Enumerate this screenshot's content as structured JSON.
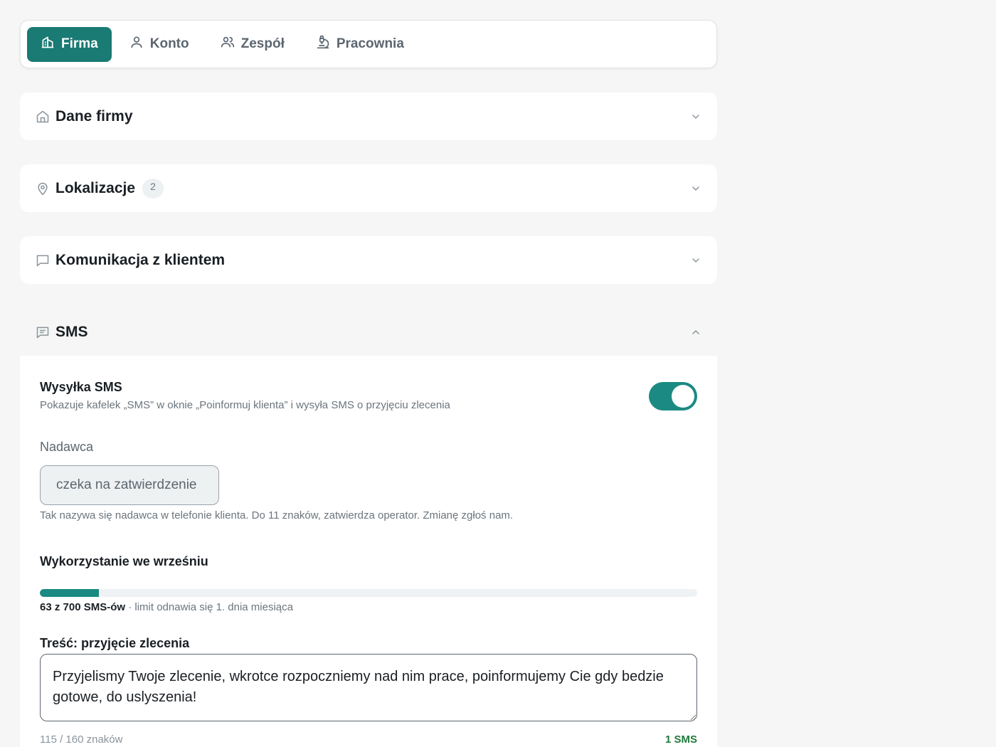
{
  "tabs": [
    {
      "label": "Firma",
      "icon": "building-icon",
      "active": true
    },
    {
      "label": "Konto",
      "icon": "user-icon",
      "active": false
    },
    {
      "label": "Zespół",
      "icon": "users-icon",
      "active": false
    },
    {
      "label": "Pracownia",
      "icon": "microscope-icon",
      "active": false
    }
  ],
  "sections": [
    {
      "title": "Dane firmy",
      "icon": "home-icon"
    },
    {
      "title": "Lokalizacje",
      "icon": "map-pin-icon",
      "badge": "2"
    },
    {
      "title": "Komunikacja z klientem",
      "icon": "chat-bubble-icon"
    }
  ],
  "sms": {
    "title": "SMS",
    "icon": "message-icon",
    "sending": {
      "label": "Wysyłka SMS",
      "description": "Pokazuje kafelek „SMS” w oknie „Poinformuj klienta” i wysyła SMS o przyjęciu zlecenia",
      "enabled": true
    },
    "sender": {
      "label": "Nadawca",
      "value": "czeka na zatwierdzenie",
      "hint": "Tak nazywa się nadawca w telefonie klienta. Do 11 znaków, zatwierdza operator. Zmianę zgłoś nam."
    },
    "usage": {
      "title": "Wykorzystanie we wrześniu",
      "used": 63,
      "limit": 700,
      "summary": "63 z 700 SMS-ów",
      "note": " · limit odnawia się 1. dnia miesiąca"
    },
    "content": {
      "title": "Treść: przyjęcie zlecenia",
      "text": "Przyjelismy Twoje zlecenie, wkrotce rozpoczniemy nad nim prace, poinformujemy Cie gdy bedzie gotowe, do uslyszenia!",
      "char_count": "115 / 160 znaków",
      "sms_count": "1 SMS"
    }
  },
  "colors": {
    "accent": "#1a7a74",
    "toggle_on": "#1a8a82",
    "sms_count": "#1f7a3a"
  }
}
